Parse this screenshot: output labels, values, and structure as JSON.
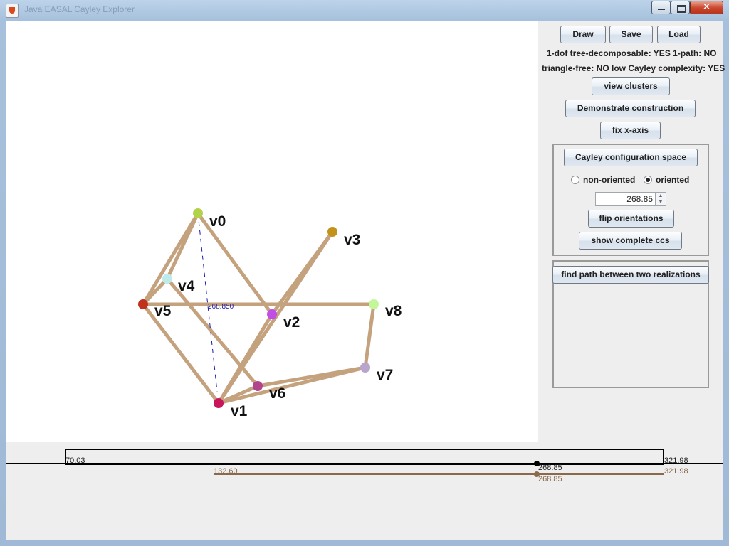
{
  "window": {
    "title": "Java EASAL Cayley Explorer"
  },
  "panel": {
    "draw_label": "Draw",
    "save_label": "Save",
    "load_label": "Load",
    "info_line1": "1-dof tree-decomposable: YES  1-path: NO",
    "info_line2": "triangle-free: NO  low Cayley complexity: YES",
    "view_clusters_label": "view clusters",
    "demonstrate_label": "Demonstrate construction",
    "fix_axis_label": "fix x-axis",
    "cayley_space_label": "Cayley configuration space",
    "non_oriented_label": "non-oriented",
    "oriented_label": "oriented",
    "selected_orientation": "oriented",
    "spinner_value": "268.85",
    "flip_label": "flip orientations",
    "show_ccs_label": "show complete ccs",
    "find_path_label": "find path between two realizations"
  },
  "graph": {
    "vertices": [
      {
        "label": "v0",
        "color": "#b3d24a"
      },
      {
        "label": "v1",
        "color": "#c8155c"
      },
      {
        "label": "v2",
        "color": "#c24ee6"
      },
      {
        "label": "v3",
        "color": "#c3921a"
      },
      {
        "label": "v4",
        "color": "#bfeaea"
      },
      {
        "label": "v5",
        "color": "#c0321c"
      },
      {
        "label": "v6",
        "color": "#b2448c"
      },
      {
        "label": "v7",
        "color": "#b8a4cc"
      },
      {
        "label": "v8",
        "color": "#c4f79a"
      }
    ],
    "edge_color": "#c4a27e",
    "dashed_edge_color": "#1a1aa6",
    "dashed_edge_label": "268.850"
  },
  "range": {
    "min_label": "70.03",
    "max_label": "321.98",
    "current_label": "268.85",
    "interval_start_label": "132.60",
    "interval_end_label": "321.98",
    "interval_current_label": "268.85",
    "interval_color": "#8a6a4a"
  },
  "colors": {
    "edge": "#c4a27e",
    "dashed": "#1a1aa6",
    "interval": "#8a6a4a"
  }
}
